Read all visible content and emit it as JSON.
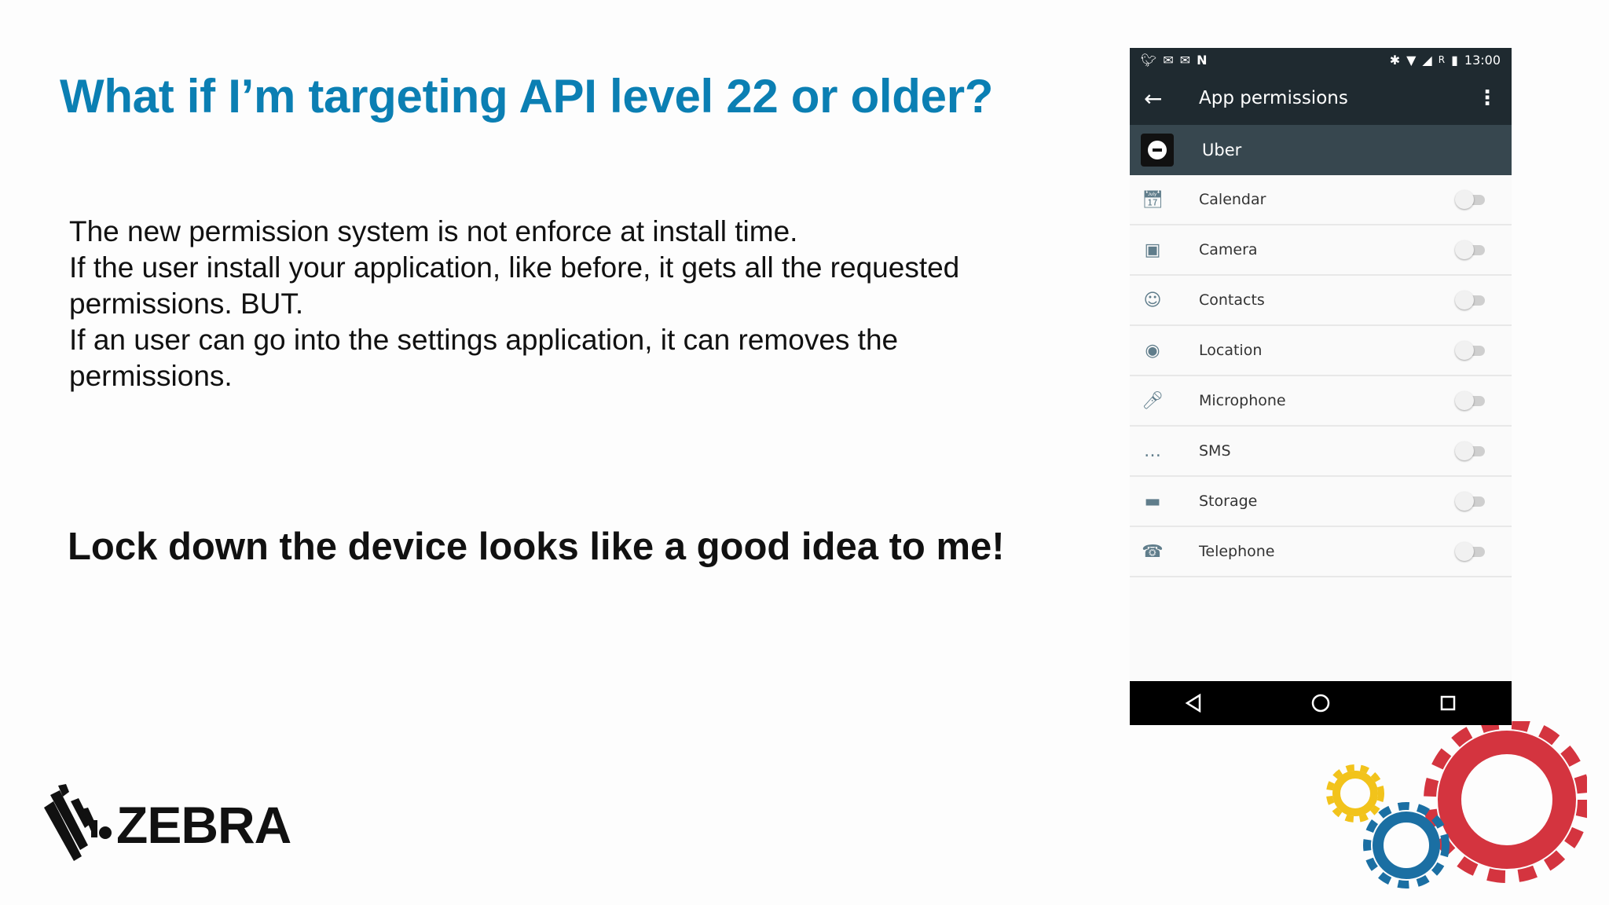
{
  "slide": {
    "title": "What if I’m targeting API level 22 or older?",
    "body_lines": [
      "The new permission system is not enforce at install time.",
      "If the user install your application, like before, it gets all the requested",
      "permissions. BUT.",
      "If an user can go into the settings application, it can removes the",
      "permissions."
    ],
    "tagline": "Lock down the device looks like a good idea to me!",
    "logo_text": "ZEBRA"
  },
  "phone": {
    "status_time": "13:00",
    "status_r": "R",
    "app_bar_title": "App permissions",
    "app_name": "Uber",
    "permissions": [
      {
        "label": "Calendar",
        "icon": "calendar-icon",
        "enabled": false
      },
      {
        "label": "Camera",
        "icon": "camera-icon",
        "enabled": false
      },
      {
        "label": "Contacts",
        "icon": "contacts-icon",
        "enabled": false
      },
      {
        "label": "Location",
        "icon": "location-icon",
        "enabled": false
      },
      {
        "label": "Microphone",
        "icon": "microphone-icon",
        "enabled": false
      },
      {
        "label": "SMS",
        "icon": "sms-icon",
        "enabled": false
      },
      {
        "label": "Storage",
        "icon": "folder-icon",
        "enabled": false
      },
      {
        "label": "Telephone",
        "icon": "phone-icon",
        "enabled": false
      }
    ]
  },
  "colors": {
    "title": "#0b7fb3",
    "app_bar": "#1f2a30",
    "app_row": "#37474f",
    "gear_red": "#d4343f",
    "gear_blue": "#1b6fa3",
    "gear_yellow": "#f2c31b"
  }
}
